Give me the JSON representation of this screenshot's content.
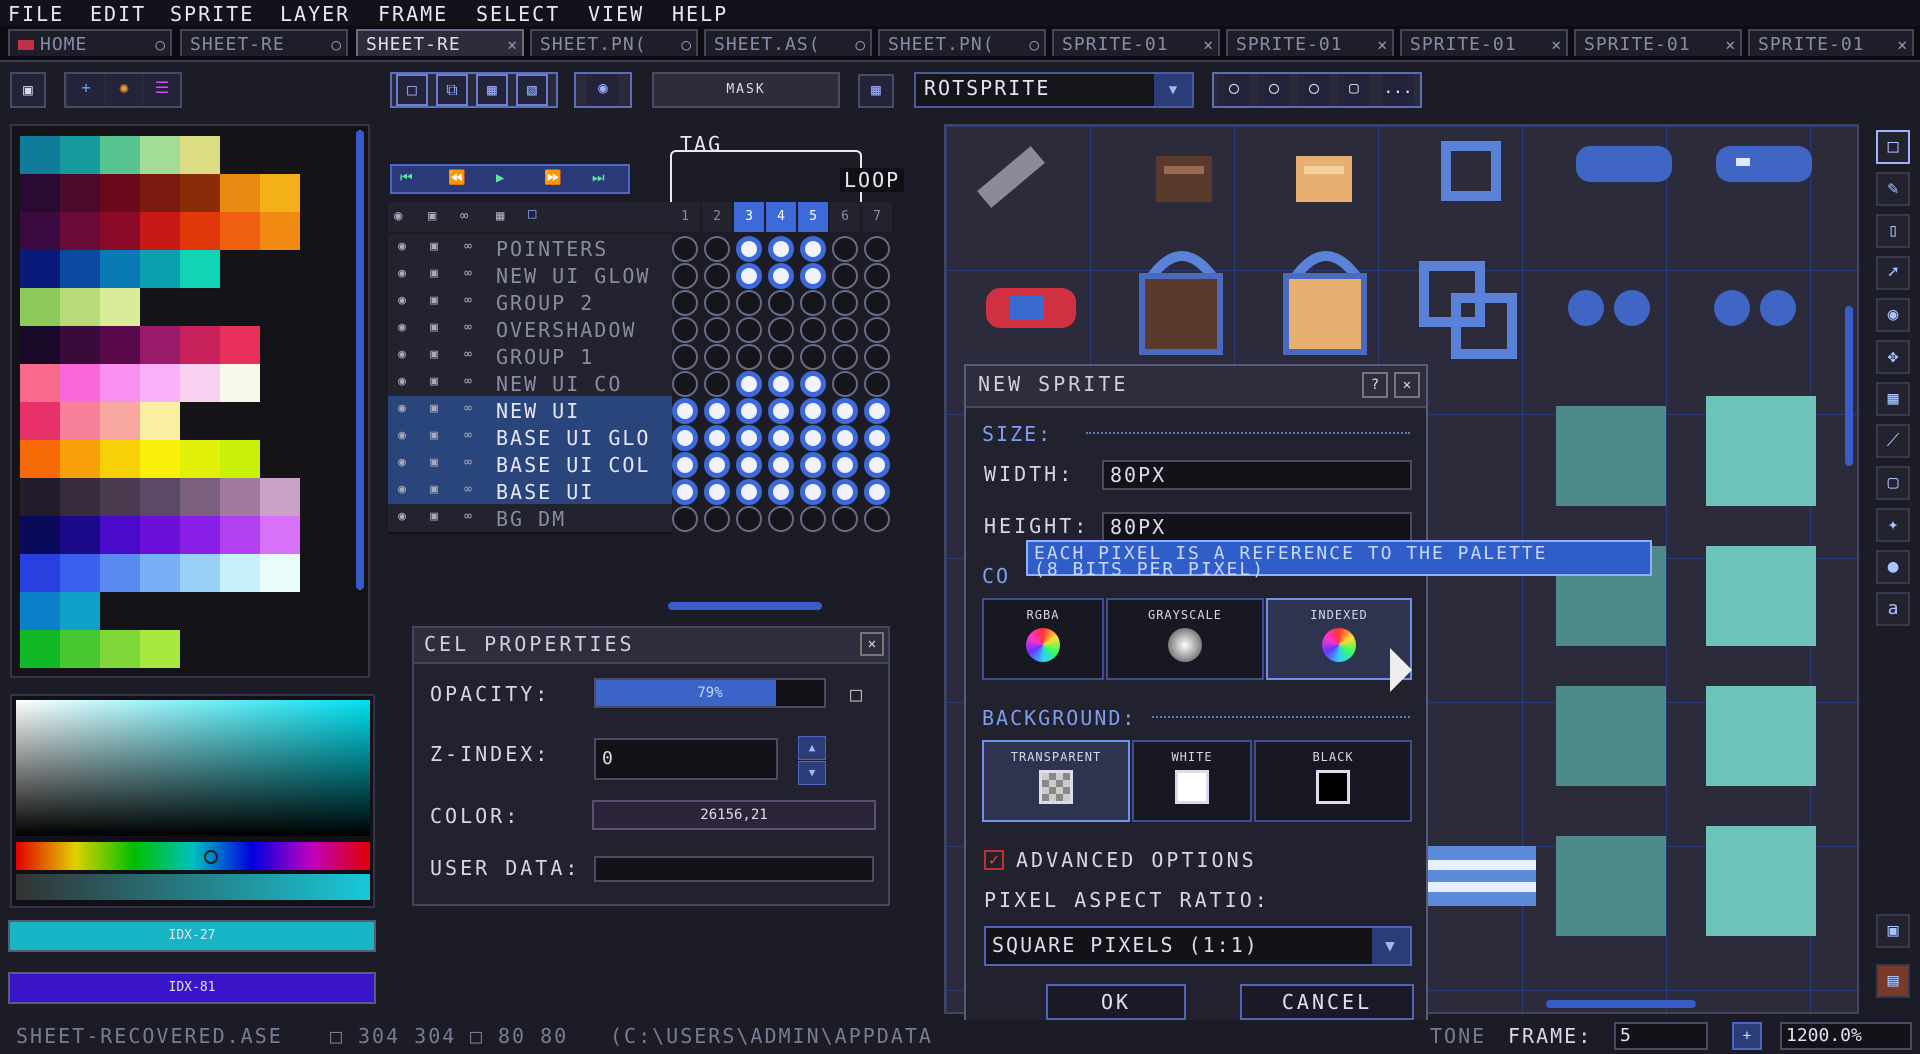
{
  "menu": [
    "FILE",
    "EDIT",
    "SPRITE",
    "LAYER",
    "FRAME",
    "SELECT",
    "VIEW",
    "HELP"
  ],
  "tabs": [
    {
      "label": "HOME",
      "close": "○"
    },
    {
      "label": "SHEET-RE",
      "close": "○"
    },
    {
      "label": "SHEET-RE",
      "close": "✕",
      "active": true
    },
    {
      "label": "SHEET.PN(",
      "close": "○"
    },
    {
      "label": "SHEET.AS(",
      "close": "○"
    },
    {
      "label": "SHEET.PN(",
      "close": "○"
    },
    {
      "label": "SPRITE-01",
      "close": "✕"
    },
    {
      "label": "SPRITE-01",
      "close": "✕"
    },
    {
      "label": "SPRITE-01",
      "close": "✕"
    },
    {
      "label": "SPRITE-01",
      "close": "✕"
    },
    {
      "label": "SPRITE-01",
      "close": "✕"
    }
  ],
  "toolbar": {
    "mask_label": "MASK",
    "rotation_algorithm": "ROTSPRITE",
    "more_label": "..."
  },
  "colors": {
    "fg_label": "IDX-27",
    "fg_color": "#16b4c4",
    "bg_label": "IDX-81",
    "bg_color": "#3a14c8",
    "accent": "#3d6ad8"
  },
  "timeline": {
    "tag_label": "TAG",
    "loop_label": "LOOP",
    "frames": [
      "1",
      "2",
      "3",
      "4",
      "5",
      "6",
      "7"
    ],
    "layers": [
      {
        "name": "POINTERS",
        "selected": false
      },
      {
        "name": "NEW UI GLOW",
        "selected": false
      },
      {
        "name": "GROUP 2",
        "selected": false
      },
      {
        "name": "OVERSHADOW",
        "selected": false
      },
      {
        "name": "GROUP 1",
        "selected": false
      },
      {
        "name": "NEW UI CO",
        "selected": false
      },
      {
        "name": "NEW UI",
        "selected": true
      },
      {
        "name": "BASE UI GLO",
        "selected": true
      },
      {
        "name": "BASE UI COL",
        "selected": true
      },
      {
        "name": "BASE UI",
        "selected": true
      },
      {
        "name": "BG DM",
        "selected": false
      }
    ]
  },
  "cel_properties": {
    "title": "CEL PROPERTIES",
    "opacity_label": "OPACITY:",
    "opacity_value": "79%",
    "opacity_fraction": 0.79,
    "zindex_label": "Z-INDEX:",
    "zindex_value": "0",
    "color_label": "COLOR:",
    "color_value": "26156,21",
    "userdata_label": "USER DATA:",
    "userdata_value": ""
  },
  "new_sprite": {
    "title": "NEW SPRITE",
    "help": "?",
    "close": "✕",
    "size_section": "SIZE:",
    "width_label": "WIDTH:",
    "width_value": "80PX",
    "height_label": "HEIGHT:",
    "height_value": "80PX",
    "color_section": "CO",
    "tooltip_line1": "EACH PIXEL IS A REFERENCE TO THE PALETTE",
    "tooltip_line2": "(8 BITS PER PIXEL)",
    "modes": [
      {
        "label": "RGBA",
        "selected": false
      },
      {
        "label": "GRAYSCALE",
        "selected": false
      },
      {
        "label": "INDEXED",
        "selected": true
      }
    ],
    "background_section": "BACKGROUND:",
    "backgrounds": [
      {
        "label": "TRANSPARENT",
        "selected": true
      },
      {
        "label": "WHITE",
        "selected": false
      },
      {
        "label": "BLACK",
        "selected": false
      }
    ],
    "advanced_label": "ADVANCED OPTIONS",
    "advanced_checked": true,
    "aspect_label": "PIXEL ASPECT RATIO:",
    "aspect_value": "SQUARE PIXELS (1:1)",
    "ok_label": "OK",
    "cancel_label": "CANCEL"
  },
  "status": {
    "filename": "SHEET-RECOVERED.ASE",
    "size": "304 304",
    "grid": "80 80",
    "path": "(C:\\USERS\\ADMIN\\APPDATA",
    "tone": "TONE",
    "frame_label": "FRAME:",
    "frame_value": "5",
    "plus": "+",
    "zoom": "1200.0%"
  }
}
